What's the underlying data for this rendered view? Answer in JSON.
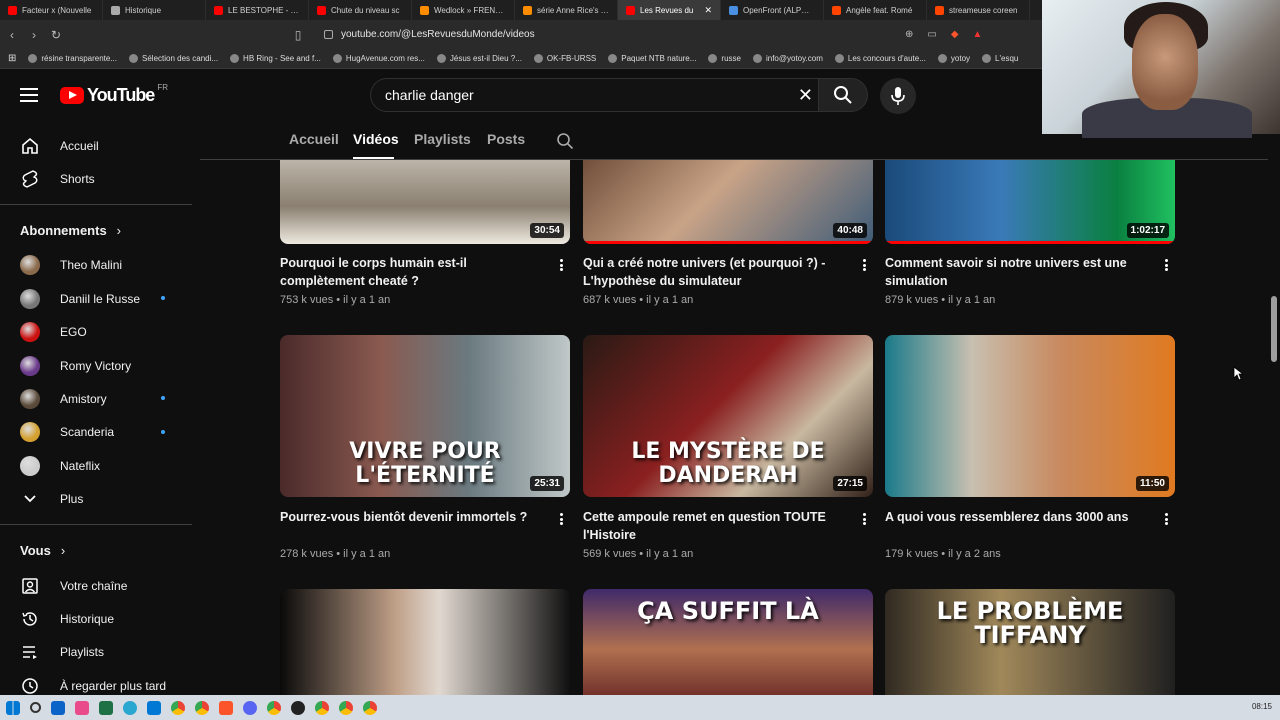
{
  "browser": {
    "tabs": [
      {
        "label": "Facteur x (Nouvelle",
        "color": "#ff0000"
      },
      {
        "label": "Historique",
        "color": "#aaaaaa"
      },
      {
        "label": "LE BESTOPHE - La s",
        "color": "#ff0000"
      },
      {
        "label": "Chute du niveau sc",
        "color": "#ff0000"
      },
      {
        "label": "Wedlock » FRENCH",
        "color": "#ff8c00"
      },
      {
        "label": "série Anne Rice's Ta",
        "color": "#ff8c00"
      },
      {
        "label": "Les Revues du",
        "color": "#ff0000",
        "active": true
      },
      {
        "label": "OpenFront (ALPHA)",
        "color": "#4a90e2"
      },
      {
        "label": "Angèle feat. Romé",
        "color": "#ff4500"
      },
      {
        "label": "streameuse coreen",
        "color": "#ff4500"
      }
    ],
    "url": "youtube.com/@LesRevuesduMonde/videos",
    "bookmarks": [
      "résine transparente...",
      "Sélection des candi...",
      "HB Ring - See and f...",
      "HugAvenue.com res...",
      "Jésus est-il Dieu ?...",
      "OK-FB-URSS",
      "Paquet NTB nature...",
      "russe",
      "info@yotoy.com",
      "Les concours d'aute...",
      "yotoy",
      "L'esqu"
    ]
  },
  "youtube": {
    "logo_text": "YouTube",
    "country": "FR",
    "search_value": "charlie danger"
  },
  "sidebar": {
    "main": [
      {
        "label": "Accueil",
        "icon": "home-icon"
      },
      {
        "label": "Shorts",
        "icon": "shorts-icon"
      }
    ],
    "subscriptions_title": "Abonnements",
    "subscriptions": [
      {
        "label": "Theo Malini",
        "color": "#8a6a4a",
        "dot": false
      },
      {
        "label": "Daniil le Russe",
        "color": "#777777",
        "dot": true
      },
      {
        "label": "EGO",
        "color": "#cc1111",
        "dot": false
      },
      {
        "label": "Romy Victory",
        "color": "#6a3a8a",
        "dot": false
      },
      {
        "label": "Amistory",
        "color": "#5a4a3a",
        "dot": true
      },
      {
        "label": "Scanderia",
        "color": "#d4a030",
        "dot": true
      },
      {
        "label": "Nateflix",
        "color": "#cccccc",
        "dot": false
      }
    ],
    "more_label": "Plus",
    "you_title": "Vous",
    "you_items": [
      {
        "label": "Votre chaîne",
        "icon": "channel-icon"
      },
      {
        "label": "Historique",
        "icon": "history-icon"
      },
      {
        "label": "Playlists",
        "icon": "playlists-icon"
      },
      {
        "label": "À regarder plus tard",
        "icon": "watch-later-icon"
      }
    ]
  },
  "channel_tabs": [
    "Accueil",
    "Vidéos",
    "Playlists",
    "Posts"
  ],
  "videos": [
    {
      "title": "Pourquoi le corps humain est-il complètement cheaté ?",
      "meta": "753 k vues • il y a 1 an",
      "duration": "30:54",
      "progress": 0
    },
    {
      "title": "Qui a créé notre univers (et pourquoi ?) - L'hypothèse du simulateur",
      "meta": "687 k vues • il y a 1 an",
      "duration": "40:48",
      "progress": 1.0
    },
    {
      "title": "Comment savoir si notre univers est une simulation",
      "meta": "879 k vues • il y a 1 an",
      "duration": "1:02:17",
      "progress": 1.0
    },
    {
      "title": "Pourrez-vous bientôt devenir immortels ?",
      "meta": "278 k vues • il y a 1 an",
      "duration": "25:31",
      "overlay": "VIVRE POUR L'ÉTERNITÉ",
      "progress": 0
    },
    {
      "title": "Cette ampoule remet en question TOUTE l'Histoire",
      "meta": "569 k vues • il y a 1 an",
      "duration": "27:15",
      "overlay": "LE MYSTÈRE DE DANDERAH",
      "progress": 0
    },
    {
      "title": "A quoi vous ressemblerez dans 3000 ans",
      "meta": "179 k vues • il y a 2 ans",
      "duration": "11:50",
      "progress": 0
    },
    {
      "title": "",
      "meta": "",
      "duration": "",
      "progress": 0
    },
    {
      "title": "",
      "meta": "",
      "duration": "",
      "overlay": "ÇA SUFFIT LÀ",
      "progress": 0
    },
    {
      "title": "",
      "meta": "",
      "duration": "",
      "overlay": "LE PROBLÈME TIFFANY",
      "progress": 0
    }
  ],
  "taskbar_clock": "08:15"
}
